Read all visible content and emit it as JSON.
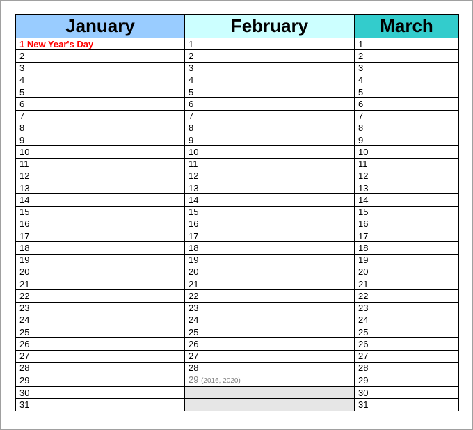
{
  "months": [
    {
      "name": "January",
      "color": "#99ccff",
      "days": [
        "1  New Year's Day",
        "2",
        "3",
        "4",
        "5",
        "6",
        "7",
        "8",
        "9",
        "10",
        "11",
        "12",
        "13",
        "14",
        "15",
        "16",
        "17",
        "18",
        "19",
        "20",
        "21",
        "22",
        "23",
        "24",
        "25",
        "26",
        "27",
        "28",
        "29",
        "30",
        "31"
      ]
    },
    {
      "name": "February",
      "color": "#ccffff",
      "days": [
        "1",
        "2",
        "3",
        "4",
        "5",
        "6",
        "7",
        "8",
        "9",
        "10",
        "11",
        "12",
        "13",
        "14",
        "15",
        "16",
        "17",
        "18",
        "19",
        "20",
        "21",
        "22",
        "23",
        "24",
        "25",
        "26",
        "27",
        "28"
      ],
      "leap_day": "29",
      "leap_note": "(2016, 2020)"
    },
    {
      "name": "March",
      "color": "#33cccc",
      "days": [
        "1",
        "2",
        "3",
        "4",
        "5",
        "6",
        "7",
        "8",
        "9",
        "10",
        "11",
        "12",
        "13",
        "14",
        "15",
        "16",
        "17",
        "18",
        "19",
        "20",
        "21",
        "22",
        "23",
        "24",
        "25",
        "26",
        "27",
        "28",
        "29",
        "30",
        "31"
      ]
    }
  ],
  "colors": {
    "holiday": "#ff0000",
    "leap": "#808080",
    "empty": "#e6e6e6"
  }
}
